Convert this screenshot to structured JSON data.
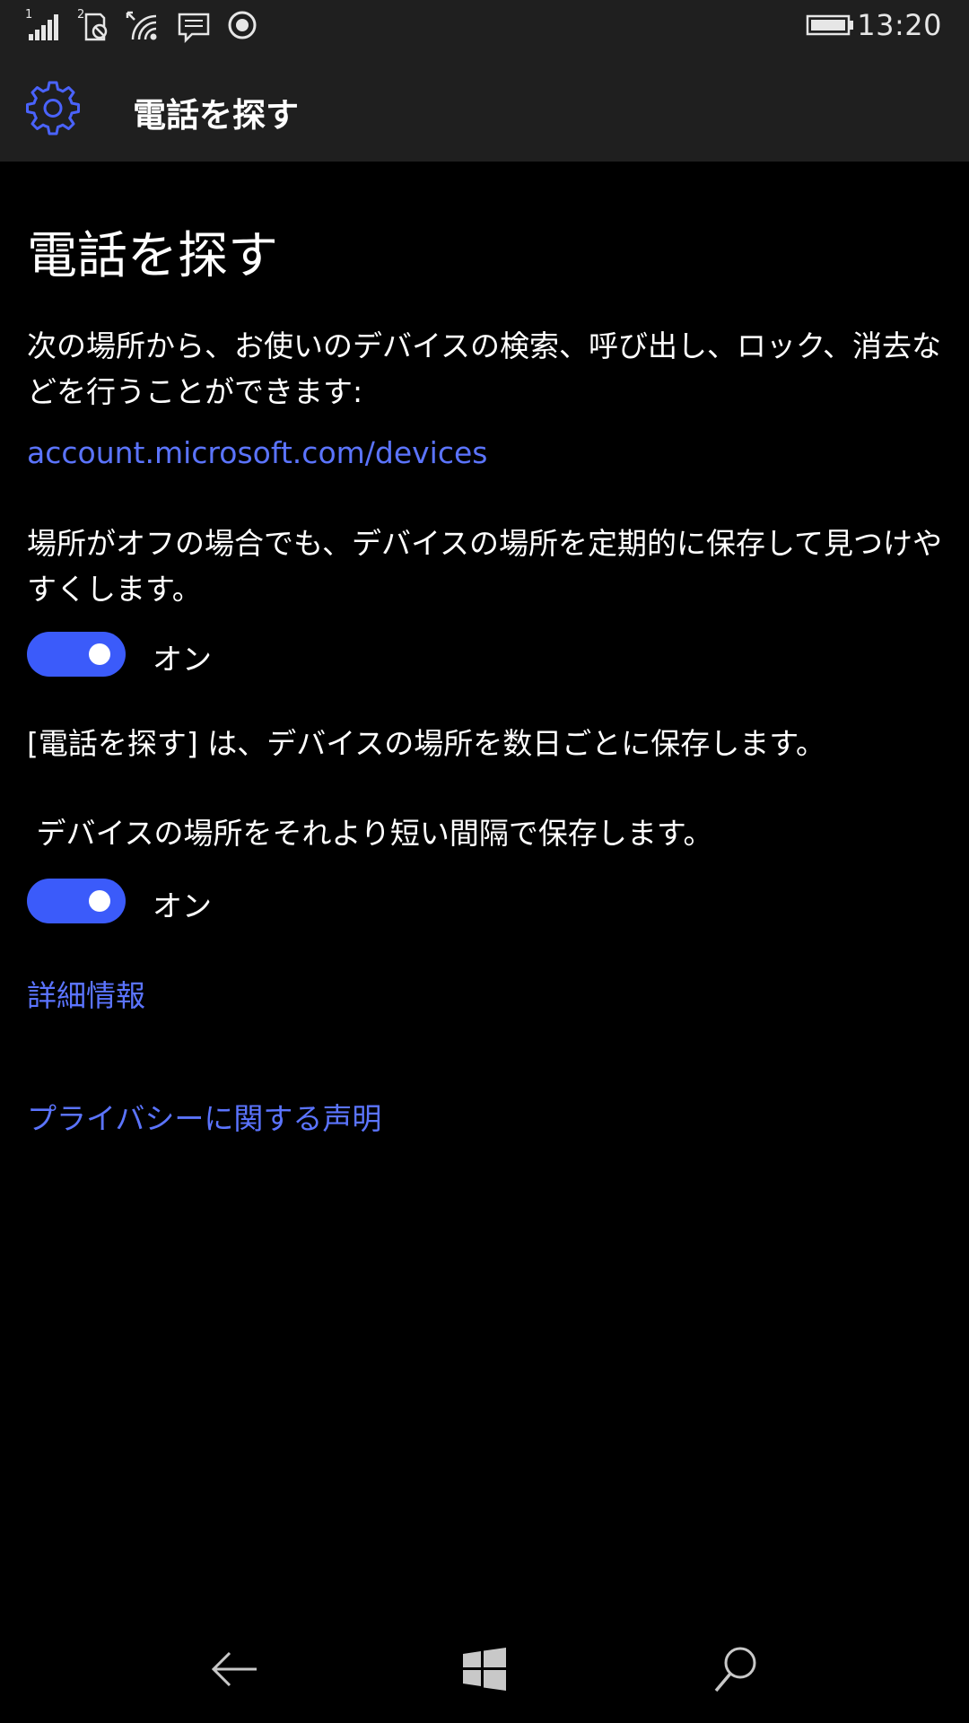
{
  "status_bar": {
    "time": "13:20",
    "sim1_label": "1",
    "sim2_label": "2",
    "icons": [
      "signal-bars-icon",
      "sim2-no-signal-icon",
      "wifi-icon",
      "message-icon",
      "record-icon",
      "battery-icon"
    ]
  },
  "header": {
    "title": "電話を探す",
    "icon": "gear-icon",
    "accent_color": "#4a63ff"
  },
  "main": {
    "page_title": "電話を探す",
    "intro_text": "次の場所から、お使いのデバイスの検索、呼び出し、ロック、消去などを行うことができます:",
    "account_link": "account.microsoft.com/devices",
    "save_location_text": "場所がオフの場合でも、デバイスの場所を定期的に保存して見つけやすくします。",
    "toggle1": {
      "state_label": "オン",
      "state": true
    },
    "frequency_text": "[電話を探す] は、デバイスの場所を数日ごとに保存します。",
    "short_interval_text": " デバイスの場所をそれより短い間隔で保存します。",
    "toggle2": {
      "state_label": "オン",
      "state": true
    },
    "more_info_link": "詳細情報",
    "privacy_link": "プライバシーに関する声明"
  },
  "nav_bar": {
    "icons": [
      "back-arrow-icon",
      "windows-start-icon",
      "search-icon"
    ]
  },
  "colors": {
    "background": "#000000",
    "bar_background": "#1f1f1f",
    "link": "#5b74ff",
    "toggle_on": "#3b5bfa"
  }
}
